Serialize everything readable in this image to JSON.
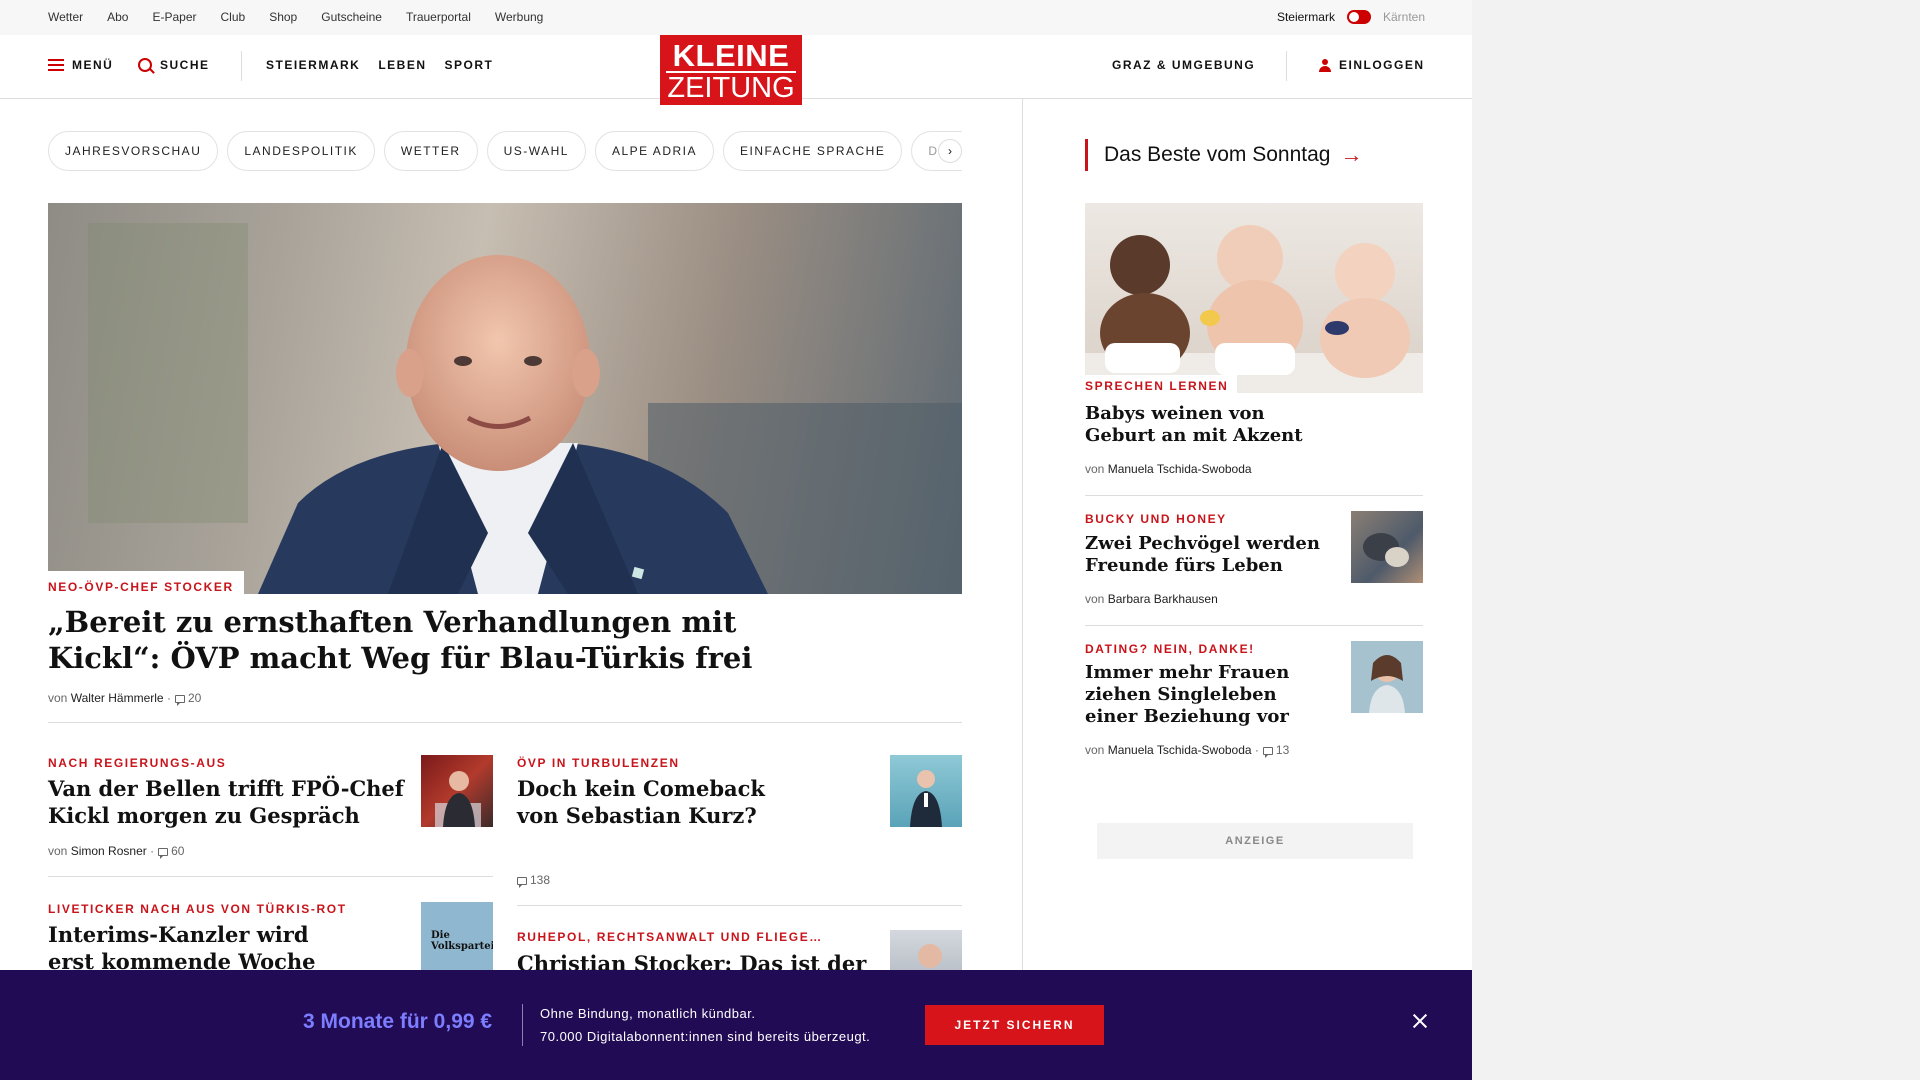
{
  "utility": {
    "links": [
      "Wetter",
      "Abo",
      "E-Paper",
      "Club",
      "Shop",
      "Gutscheine",
      "Trauerportal",
      "Werbung"
    ],
    "region_active": "Steiermark",
    "region_other": "Kärnten"
  },
  "header": {
    "menu": "MENÜ",
    "search": "SUCHE",
    "nav": [
      "STEIERMARK",
      "LEBEN",
      "SPORT"
    ],
    "logo_line1": "KLEINE",
    "logo_line2": "ZEITUNG",
    "local": "GRAZ & UMGEBUNG",
    "login": "EINLOGGEN"
  },
  "pills": [
    "JAHRESVORSCHAU",
    "LANDESPOLITIK",
    "WETTER",
    "US-WAHL",
    "ALPE ADRIA",
    "EINFACHE SPRACHE",
    "DOS"
  ],
  "hero": {
    "kicker": "NEO-ÖVP-CHEF STOCKER",
    "headline_1": "„Bereit zu ernsthaften Verhandlungen mit",
    "headline_2": "Kickl“: ÖVP macht Weg für Blau-Türkis frei",
    "by": "von",
    "author": "Walter Hämmerle",
    "comments": "20"
  },
  "articles": [
    {
      "kicker": "NACH REGIERUNGS-AUS",
      "h1": "Van der Bellen trifft FPÖ-Chef",
      "h2": "Kickl morgen zu Gespräch",
      "by": "von",
      "author": "Simon Rosner",
      "comments": "60"
    },
    {
      "kicker": "ÖVP IN TURBULENZEN",
      "h1": "Doch kein Comeback",
      "h2": "von Sebastian Kurz?",
      "comments": "138"
    },
    {
      "kicker": "LIVETICKER NACH AUS VON TÜRKIS-ROT",
      "h1": "Interims-Kanzler wird",
      "h2": "erst kommende Woche",
      "thumb_text": "Die Volkspartei"
    },
    {
      "kicker": "RUHEPOL, RECHTSANWALT UND FLIEGE…",
      "h1": "Christian Stocker: Das ist der"
    }
  ],
  "sidebar": {
    "title": "Das Beste vom Sonntag",
    "arrow": "→",
    "items": [
      {
        "kicker": "SPRECHEN LERNEN",
        "h1": "Babys weinen von",
        "h2": "Geburt an mit Akzent",
        "by": "von",
        "author": "Manuela Tschida-Swoboda"
      },
      {
        "kicker": "BUCKY UND HONEY",
        "h1": "Zwei Pechvögel werden",
        "h2": "Freunde fürs Leben",
        "by": "von",
        "author": "Barbara Barkhausen"
      },
      {
        "kicker": "DATING? NEIN, DANKE!",
        "h1": "Immer mehr Frauen",
        "h2": "ziehen Singleleben",
        "h3": "einer Beziehung vor",
        "by": "von",
        "author": "Manuela Tschida-Swoboda",
        "comments": "13"
      }
    ],
    "ad": "ANZEIGE"
  },
  "banner": {
    "offer": "3 Monate für 0,99 €",
    "line1": "Ohne Bindung, monatlich kündbar.",
    "line2": "70.000 Digitalabonnent:innen sind bereits überzeugt.",
    "cta": "JETZT SICHERN"
  },
  "colors": {
    "brand_red": "#d7141a",
    "banner_bg": "#210b55",
    "offer_blue": "#7c7dff"
  }
}
